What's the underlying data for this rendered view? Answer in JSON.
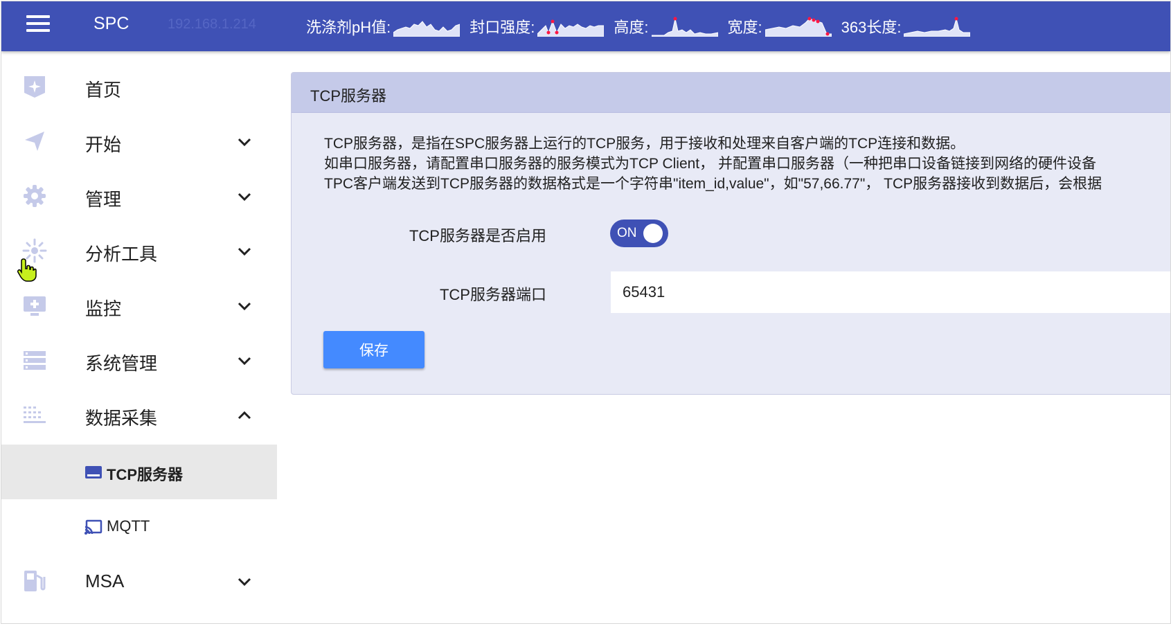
{
  "colors": {
    "primary": "#3f51b5",
    "panel_bg": "#e8eaf6",
    "panel_header_bg": "#c5cae9",
    "save_button": "#448aff",
    "active_item_bg": "#e8e8e8",
    "icon_color": "#c5cae9",
    "alert_point": "#ff1744"
  },
  "header": {
    "menu_icon": "hamburger-menu-icon",
    "app_title": "SPC",
    "server_ip": "192.168.1.214",
    "metrics": [
      {
        "label": "洗涤剂pH值:",
        "icon": "sparkline-chart"
      },
      {
        "label": "封口强度:",
        "icon": "sparkline-chart"
      },
      {
        "label": "高度:",
        "icon": "sparkline-chart"
      },
      {
        "label": "宽度:",
        "icon": "sparkline-chart"
      },
      {
        "label": "363长度:",
        "icon": "sparkline-chart"
      }
    ]
  },
  "sidebar": {
    "items": [
      {
        "label": "首页",
        "icon": "home-star-icon",
        "expandable": false
      },
      {
        "label": "开始",
        "icon": "send-icon",
        "expandable": true,
        "expanded": false
      },
      {
        "label": "管理",
        "icon": "gear-icon",
        "expandable": true,
        "expanded": false
      },
      {
        "label": "分析工具",
        "icon": "analysis-sparkle-icon",
        "expandable": true,
        "expanded": false
      },
      {
        "label": "监控",
        "icon": "monitor-plus-icon",
        "expandable": true,
        "expanded": false
      },
      {
        "label": "系统管理",
        "icon": "server-list-icon",
        "expandable": true,
        "expanded": false
      },
      {
        "label": "数据采集",
        "icon": "grid-dots-icon",
        "expandable": true,
        "expanded": true
      },
      {
        "label": "MSA",
        "icon": "fuel-pump-icon",
        "expandable": true,
        "expanded": false
      }
    ],
    "sub_items": [
      {
        "label": "TCP服务器",
        "icon": "tcp-server-icon",
        "active": true
      },
      {
        "label": "MQTT",
        "icon": "cast-icon",
        "active": false
      }
    ]
  },
  "panel": {
    "title": "TCP服务器",
    "description_lines": [
      "TCP服务器，是指在SPC服务器上运行的TCP服务，用于接收和处理来自客户端的TCP连接和数据。",
      "如串口服务器，请配置串口服务器的服务模式为TCP Client， 并配置串口服务器（一种把串口设备链接到网络的硬件设备",
      "TPC客户端发送到TCP服务器的数据格式是一个字符串\"item_id,value\"，如\"57,66.77\"， TCP服务器接收到数据后，会根据"
    ],
    "enable_label": "TCP服务器是否启用",
    "enable_state": "ON",
    "port_label": "TCP服务器端口",
    "port_value": "65431",
    "save_label": "保存"
  }
}
